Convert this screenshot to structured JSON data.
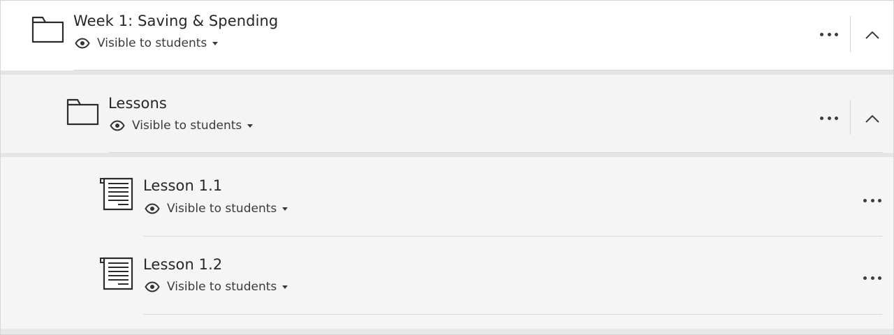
{
  "items": {
    "week1": {
      "title": "Week 1: Saving & Spending",
      "visibility": "Visible to students",
      "icon": "folder-icon"
    },
    "lessons": {
      "title": "Lessons",
      "visibility": "Visible to students",
      "icon": "folder-icon"
    },
    "lesson11": {
      "title": "Lesson 1.1",
      "visibility": "Visible to students",
      "icon": "document-icon"
    },
    "lesson12": {
      "title": "Lesson 1.2",
      "visibility": "Visible to students",
      "icon": "document-icon"
    }
  },
  "colors": {
    "text": "#262626",
    "icon": "#2b2b2b",
    "panel_bg": "#f4f4f4",
    "divider": "#d9d9d9"
  }
}
